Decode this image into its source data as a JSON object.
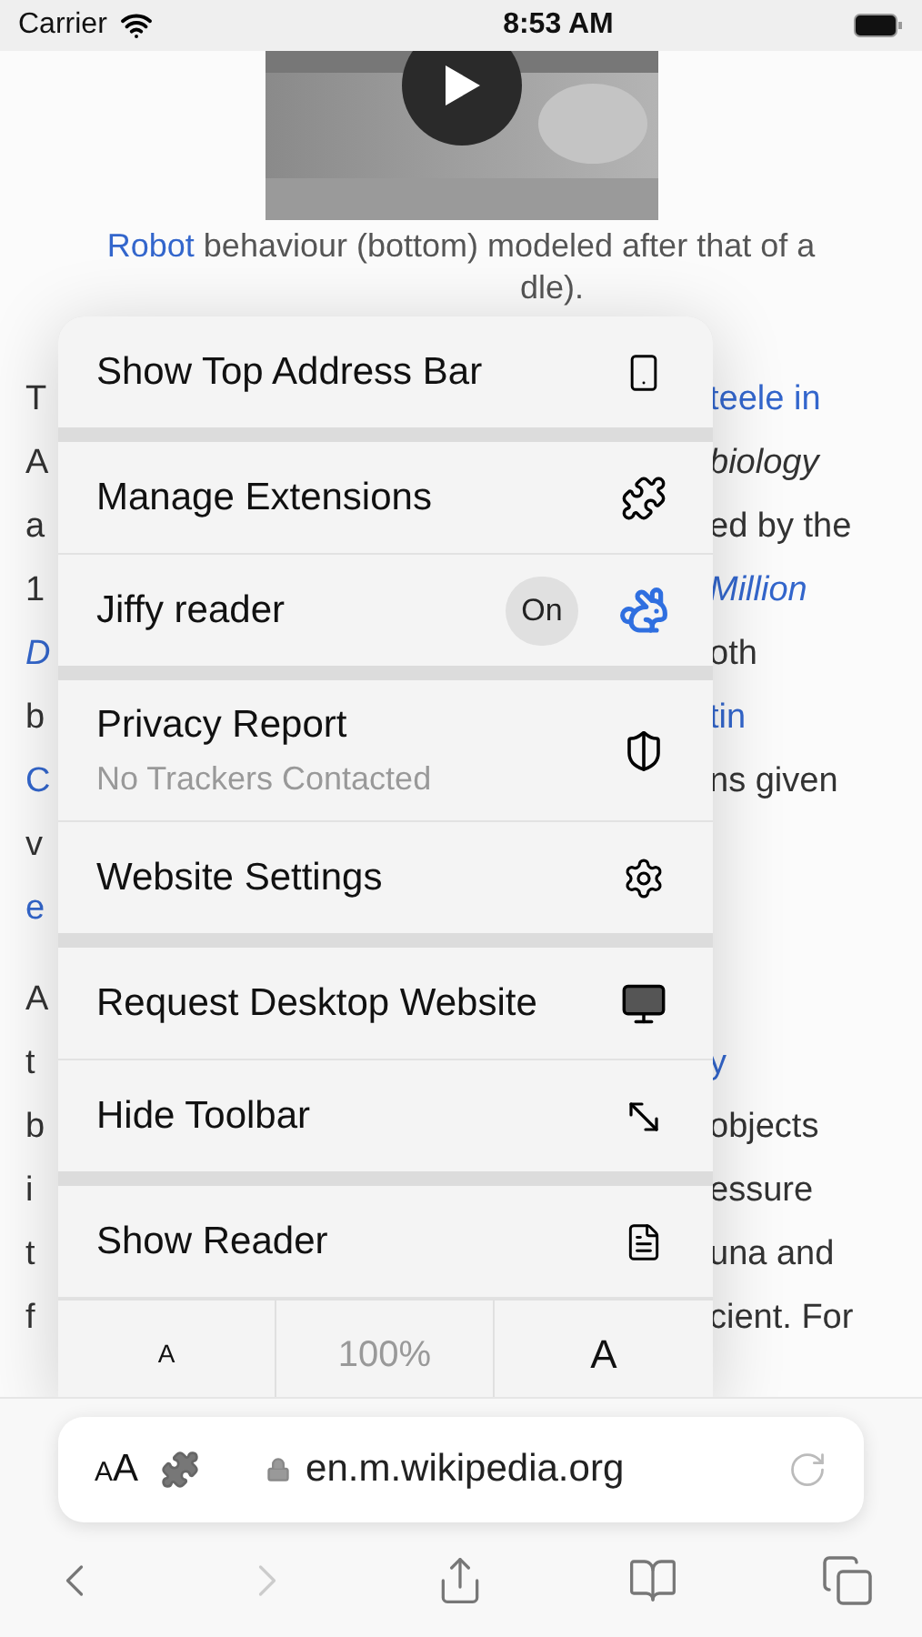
{
  "status_bar": {
    "carrier": "Carrier",
    "time": "8:53 AM"
  },
  "article": {
    "caption": {
      "link": "Robot",
      "text": " behaviour (bottom) modeled after that of a",
      "line_2_fragment": "dle)."
    },
    "paragraphs": [
      {
        "lines": [
          {
            "left": {
              "text": "T",
              "kind": "plain"
            },
            "right": {
              "text": "teele in",
              "kind": "link"
            }
          },
          {
            "left": {
              "text": "A",
              "kind": "plain"
            },
            "right": {
              "text": "biology",
              "kind": "italic"
            }
          },
          {
            "left": {
              "text": "a",
              "kind": "plain"
            },
            "right": {
              "text": "ed by the",
              "kind": "plain"
            }
          },
          {
            "left": {
              "text": "1",
              "kind": "plain"
            },
            "right": {
              "text": "Million",
              "kind": "linkitalic"
            }
          },
          {
            "left": {
              "text": "D",
              "kind": "linkitalic"
            },
            "right": {
              "text": "oth",
              "kind": "plain"
            }
          },
          {
            "left": {
              "text": "b",
              "kind": "plain"
            },
            "right": {
              "text": "tin",
              "kind": "link"
            }
          },
          {
            "left": {
              "text": "C",
              "kind": "link"
            },
            "right": {
              "text": "ns given",
              "kind": "plain"
            }
          },
          {
            "left": {
              "text": "v",
              "kind": "plain"
            }
          },
          {
            "left": {
              "text": "e",
              "kind": "link"
            }
          }
        ]
      },
      {
        "lines": [
          {
            "left": {
              "text": "A",
              "kind": "plain"
            }
          },
          {
            "left": {
              "text": "t",
              "kind": "plain"
            },
            "right": {
              "text": "y",
              "kind": "link"
            }
          },
          {
            "left": {
              "text": "b",
              "kind": "plain"
            },
            "right": {
              "text": "objects",
              "kind": "plain"
            }
          },
          {
            "left": {
              "text": "i",
              "kind": "plain"
            },
            "right": {
              "text": "essure",
              "kind": "plain"
            }
          },
          {
            "left": {
              "text": "t",
              "kind": "plain"
            },
            "right": {
              "text": "una and",
              "kind": "plain"
            }
          },
          {
            "left": {
              "text": "f",
              "kind": "plain"
            },
            "right": {
              "text": "cient. For",
              "kind": "plain"
            }
          }
        ]
      }
    ]
  },
  "menu": {
    "groups": [
      {
        "items": [
          {
            "label": "Show Top Address Bar"
          }
        ]
      },
      {
        "items": [
          {
            "label": "Manage Extensions"
          },
          {
            "label": "Jiffy reader",
            "badge": "On"
          }
        ]
      },
      {
        "items": [
          {
            "label": "Privacy Report",
            "subtitle": "No Trackers Contacted"
          },
          {
            "label": "Website Settings"
          }
        ]
      },
      {
        "items": [
          {
            "label": "Request Desktop Website"
          },
          {
            "label": "Hide Toolbar"
          }
        ]
      },
      {
        "items": [
          {
            "label": "Show Reader"
          }
        ]
      }
    ],
    "text_size": {
      "decrease": "A",
      "zoom": "100%",
      "increase": "A"
    }
  },
  "address_bar": {
    "format_button": [
      "A",
      "A"
    ],
    "url": "en.m.wikipedia.org"
  },
  "toolbar": {
    "back_disabled": false,
    "forward_disabled": true
  }
}
